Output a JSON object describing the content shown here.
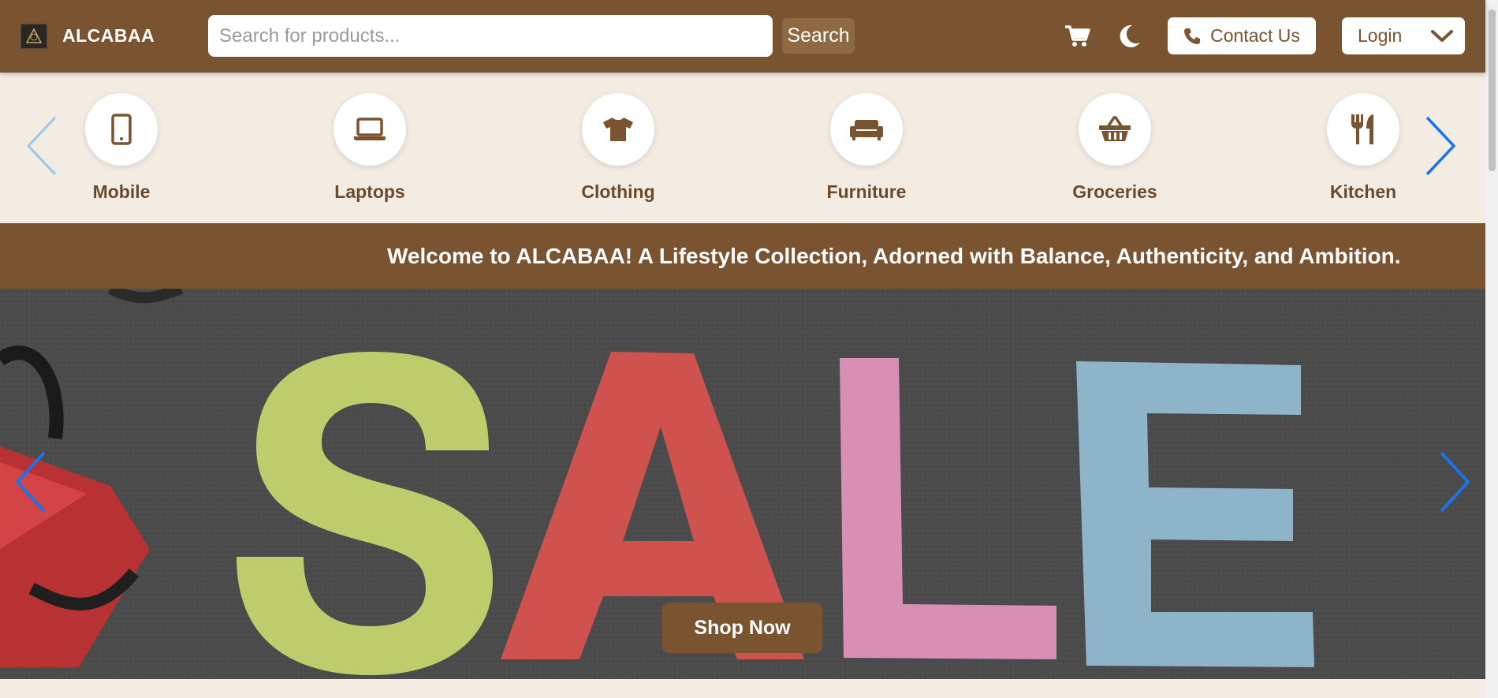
{
  "header": {
    "brand": "ALCABAA",
    "search_placeholder": "Search for products...",
    "search_label": "Search",
    "contact_label": "Contact Us",
    "login_label": "Login"
  },
  "categories": [
    {
      "label": "Mobile",
      "icon": "mobile-icon"
    },
    {
      "label": "Laptops",
      "icon": "laptop-icon"
    },
    {
      "label": "Clothing",
      "icon": "tshirt-icon"
    },
    {
      "label": "Furniture",
      "icon": "couch-icon"
    },
    {
      "label": "Groceries",
      "icon": "basket-icon"
    },
    {
      "label": "Kitchen",
      "icon": "utensils-icon"
    }
  ],
  "welcome": "Welcome to ALCABAA! A Lifestyle Collection, Adorned with Balance, Authenticity, and Ambition.",
  "hero": {
    "slide_text": "SALE",
    "cta_label": "Shop Now"
  },
  "colors": {
    "brand_brown": "#7a5331",
    "background_cream": "#f3ece3",
    "accent_blue": "#1a73e8"
  }
}
